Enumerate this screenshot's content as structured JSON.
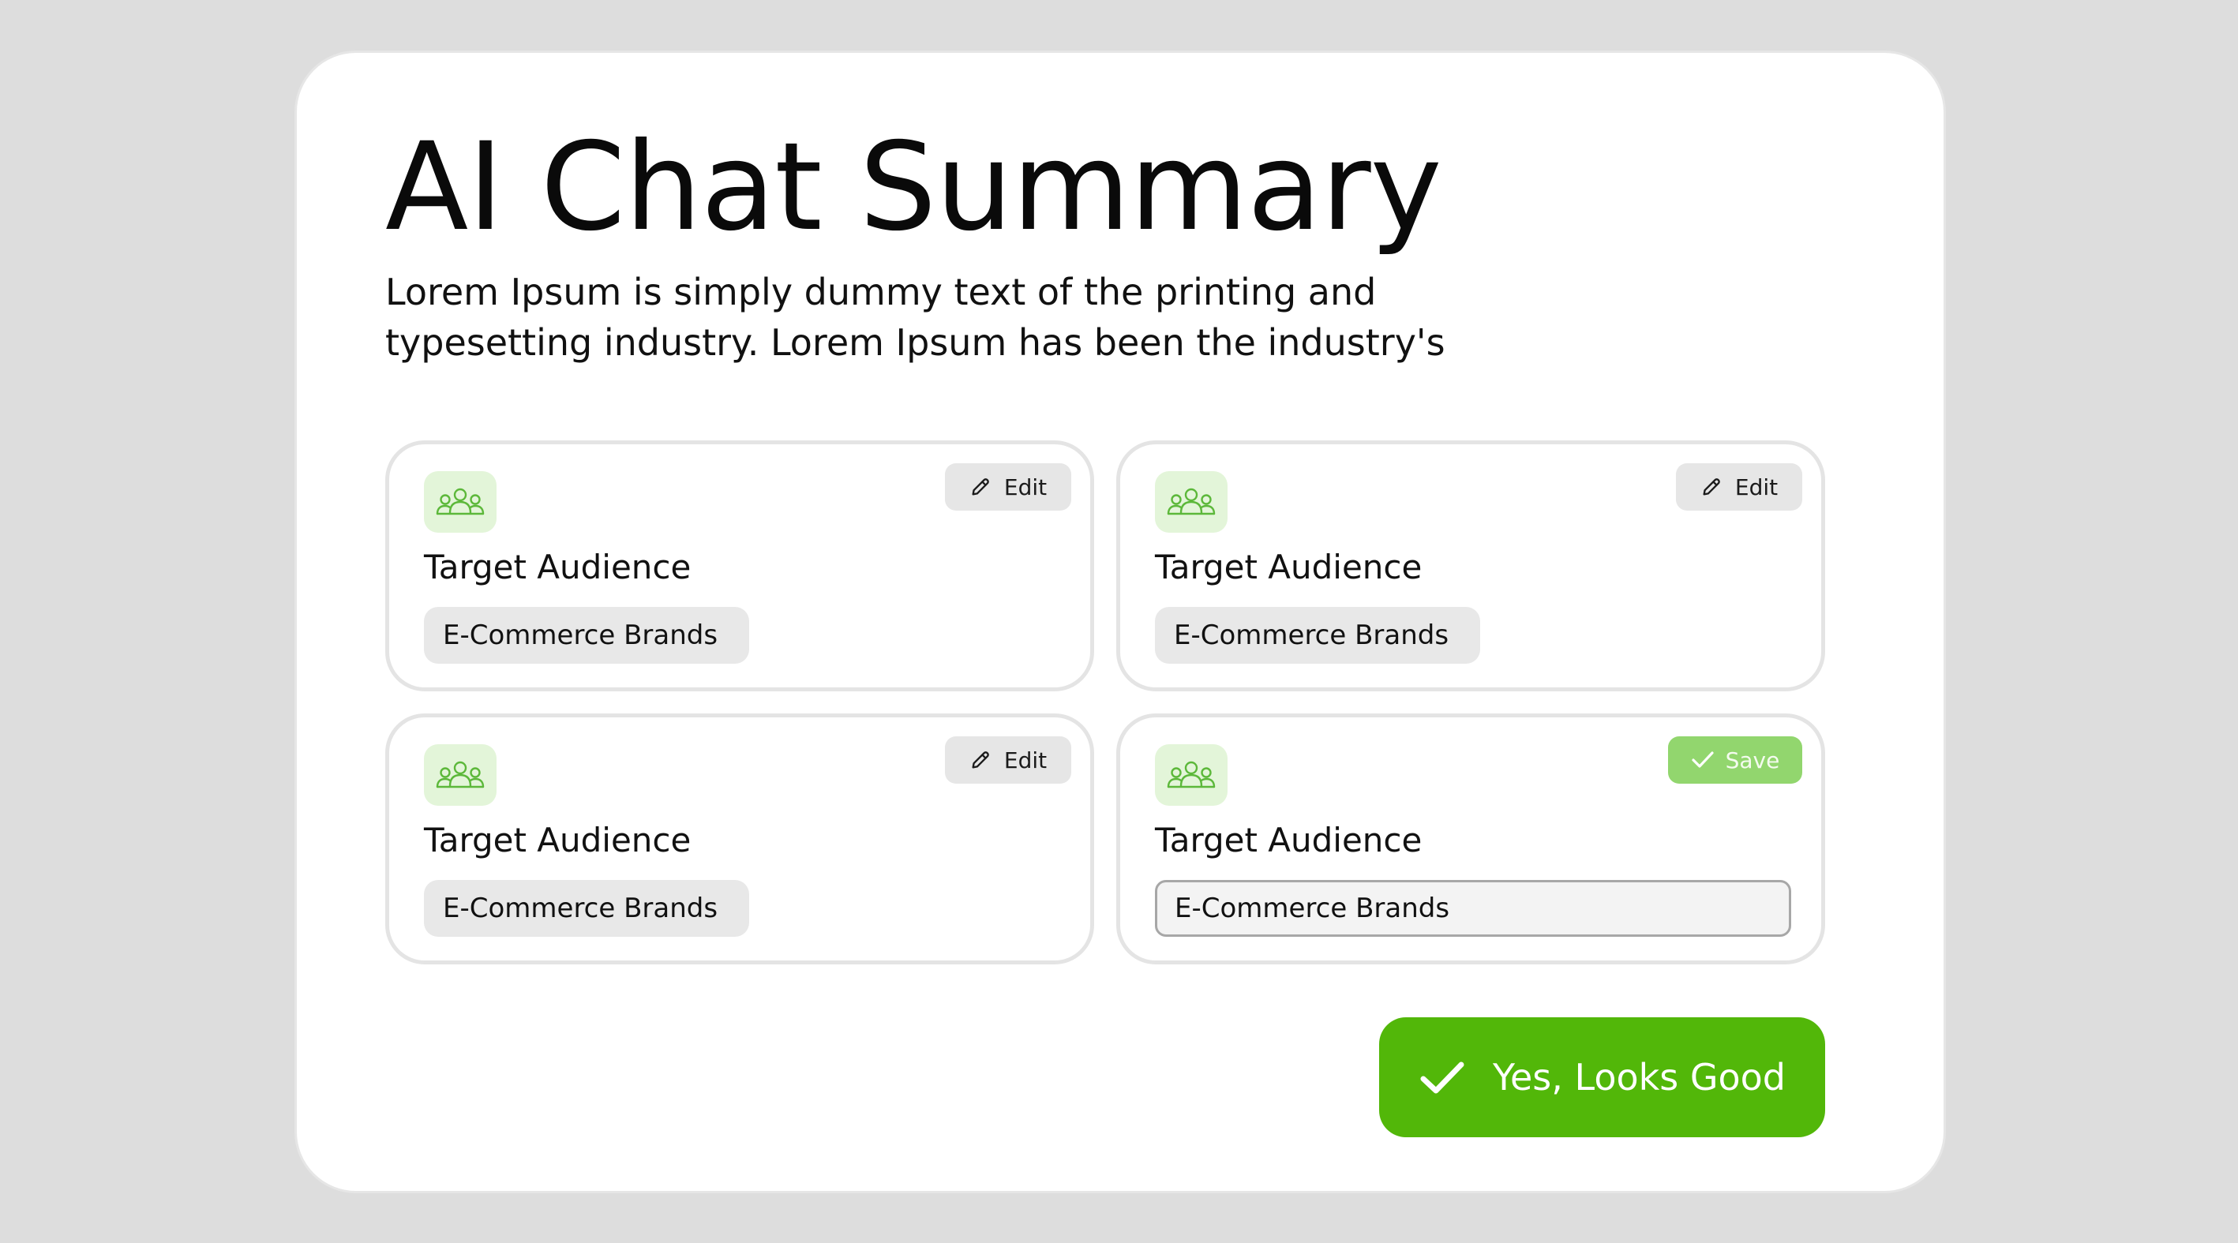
{
  "summary": {
    "title": "AI Chat Summary",
    "description": "Lorem Ipsum is simply dummy text of the printing and\ntypesetting industry. Lorem Ipsum has been the industry's"
  },
  "theme": {
    "accent": "#52b709",
    "accent_light": "#92d66e",
    "icon_bg": "#e3f5d9",
    "icon_stroke": "#5cb83a",
    "chip_bg": "#e8e8e8",
    "card_border": "#e4e4e4"
  },
  "cards": [
    {
      "icon": "audience-icon",
      "label": "Target Audience",
      "value": "E-Commerce Brands",
      "mode": "view",
      "action_label": "Edit",
      "action_icon": "pencil-icon"
    },
    {
      "icon": "audience-icon",
      "label": "Target Audience",
      "value": "E-Commerce Brands",
      "mode": "view",
      "action_label": "Edit",
      "action_icon": "pencil-icon"
    },
    {
      "icon": "audience-icon",
      "label": "Target Audience",
      "value": "E-Commerce Brands",
      "mode": "view",
      "action_label": "Edit",
      "action_icon": "pencil-icon"
    },
    {
      "icon": "audience-icon",
      "label": "Target Audience",
      "value": "E-Commerce Brands",
      "mode": "editing",
      "action_label": "Save",
      "action_icon": "check-icon"
    }
  ],
  "confirm": {
    "label": "Yes, Looks Good",
    "icon": "check-icon"
  }
}
